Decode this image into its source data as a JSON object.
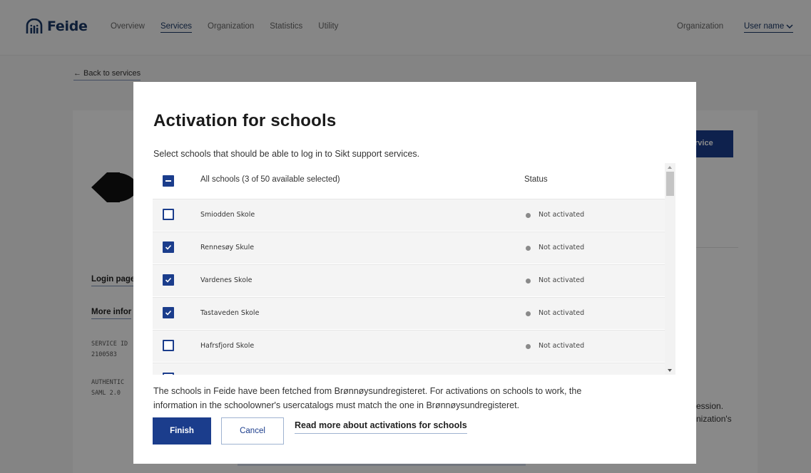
{
  "topnav": {
    "brand": "Feide",
    "items": [
      {
        "label": "Overview",
        "active": false
      },
      {
        "label": "Services",
        "active": true
      },
      {
        "label": "Organization",
        "active": false
      },
      {
        "label": "Statistics",
        "active": false
      },
      {
        "label": "Utility",
        "active": false
      }
    ],
    "organization_label": "Organization",
    "user_label": "User name"
  },
  "background": {
    "back_link": "← Back to services",
    "service_button_text": "rvice",
    "login_page_label": "Login page",
    "more_info_label": "More infor",
    "service_id_label": "SERVICE ID",
    "service_id_value": "2100583",
    "auth_label": "AUTHENTIC",
    "auth_value": "SAML 2.0",
    "side_text_1": "ession.",
    "side_text_2": "nization's"
  },
  "modal": {
    "title": "Activation for schools",
    "subtitle": "Select schools that should be able to log in to Sikt support services.",
    "header": {
      "label": "All schools (3 of 50 available selected)",
      "status_label": "Status",
      "state": "mixed"
    },
    "schools": [
      {
        "name": "Smiodden Skole",
        "checked": false,
        "status": "Not activated"
      },
      {
        "name": "Rennesøy Skule",
        "checked": true,
        "status": "Not activated"
      },
      {
        "name": "Vardenes Skole",
        "checked": true,
        "status": "Not activated"
      },
      {
        "name": "Tastaveden Skole",
        "checked": true,
        "status": "Not activated"
      },
      {
        "name": "Hafrsfjord Skole",
        "checked": false,
        "status": "Not activated"
      }
    ],
    "note_line_1": "The schools in Feide have been fetched from Brønnøysundregisteret. For activations on schools to work, the",
    "note_line_2": "information in the schoolowner's usercatalogs must match the one in Brønnøysundregisteret.",
    "finish_label": "Finish",
    "cancel_label": "Cancel",
    "read_more_label": "Read more about activations for schools"
  },
  "colors": {
    "primary": "#1b3d8c",
    "brand": "#1b3764",
    "status_dot": "#8a8a8a",
    "row_bg": "#f4f4f4"
  }
}
